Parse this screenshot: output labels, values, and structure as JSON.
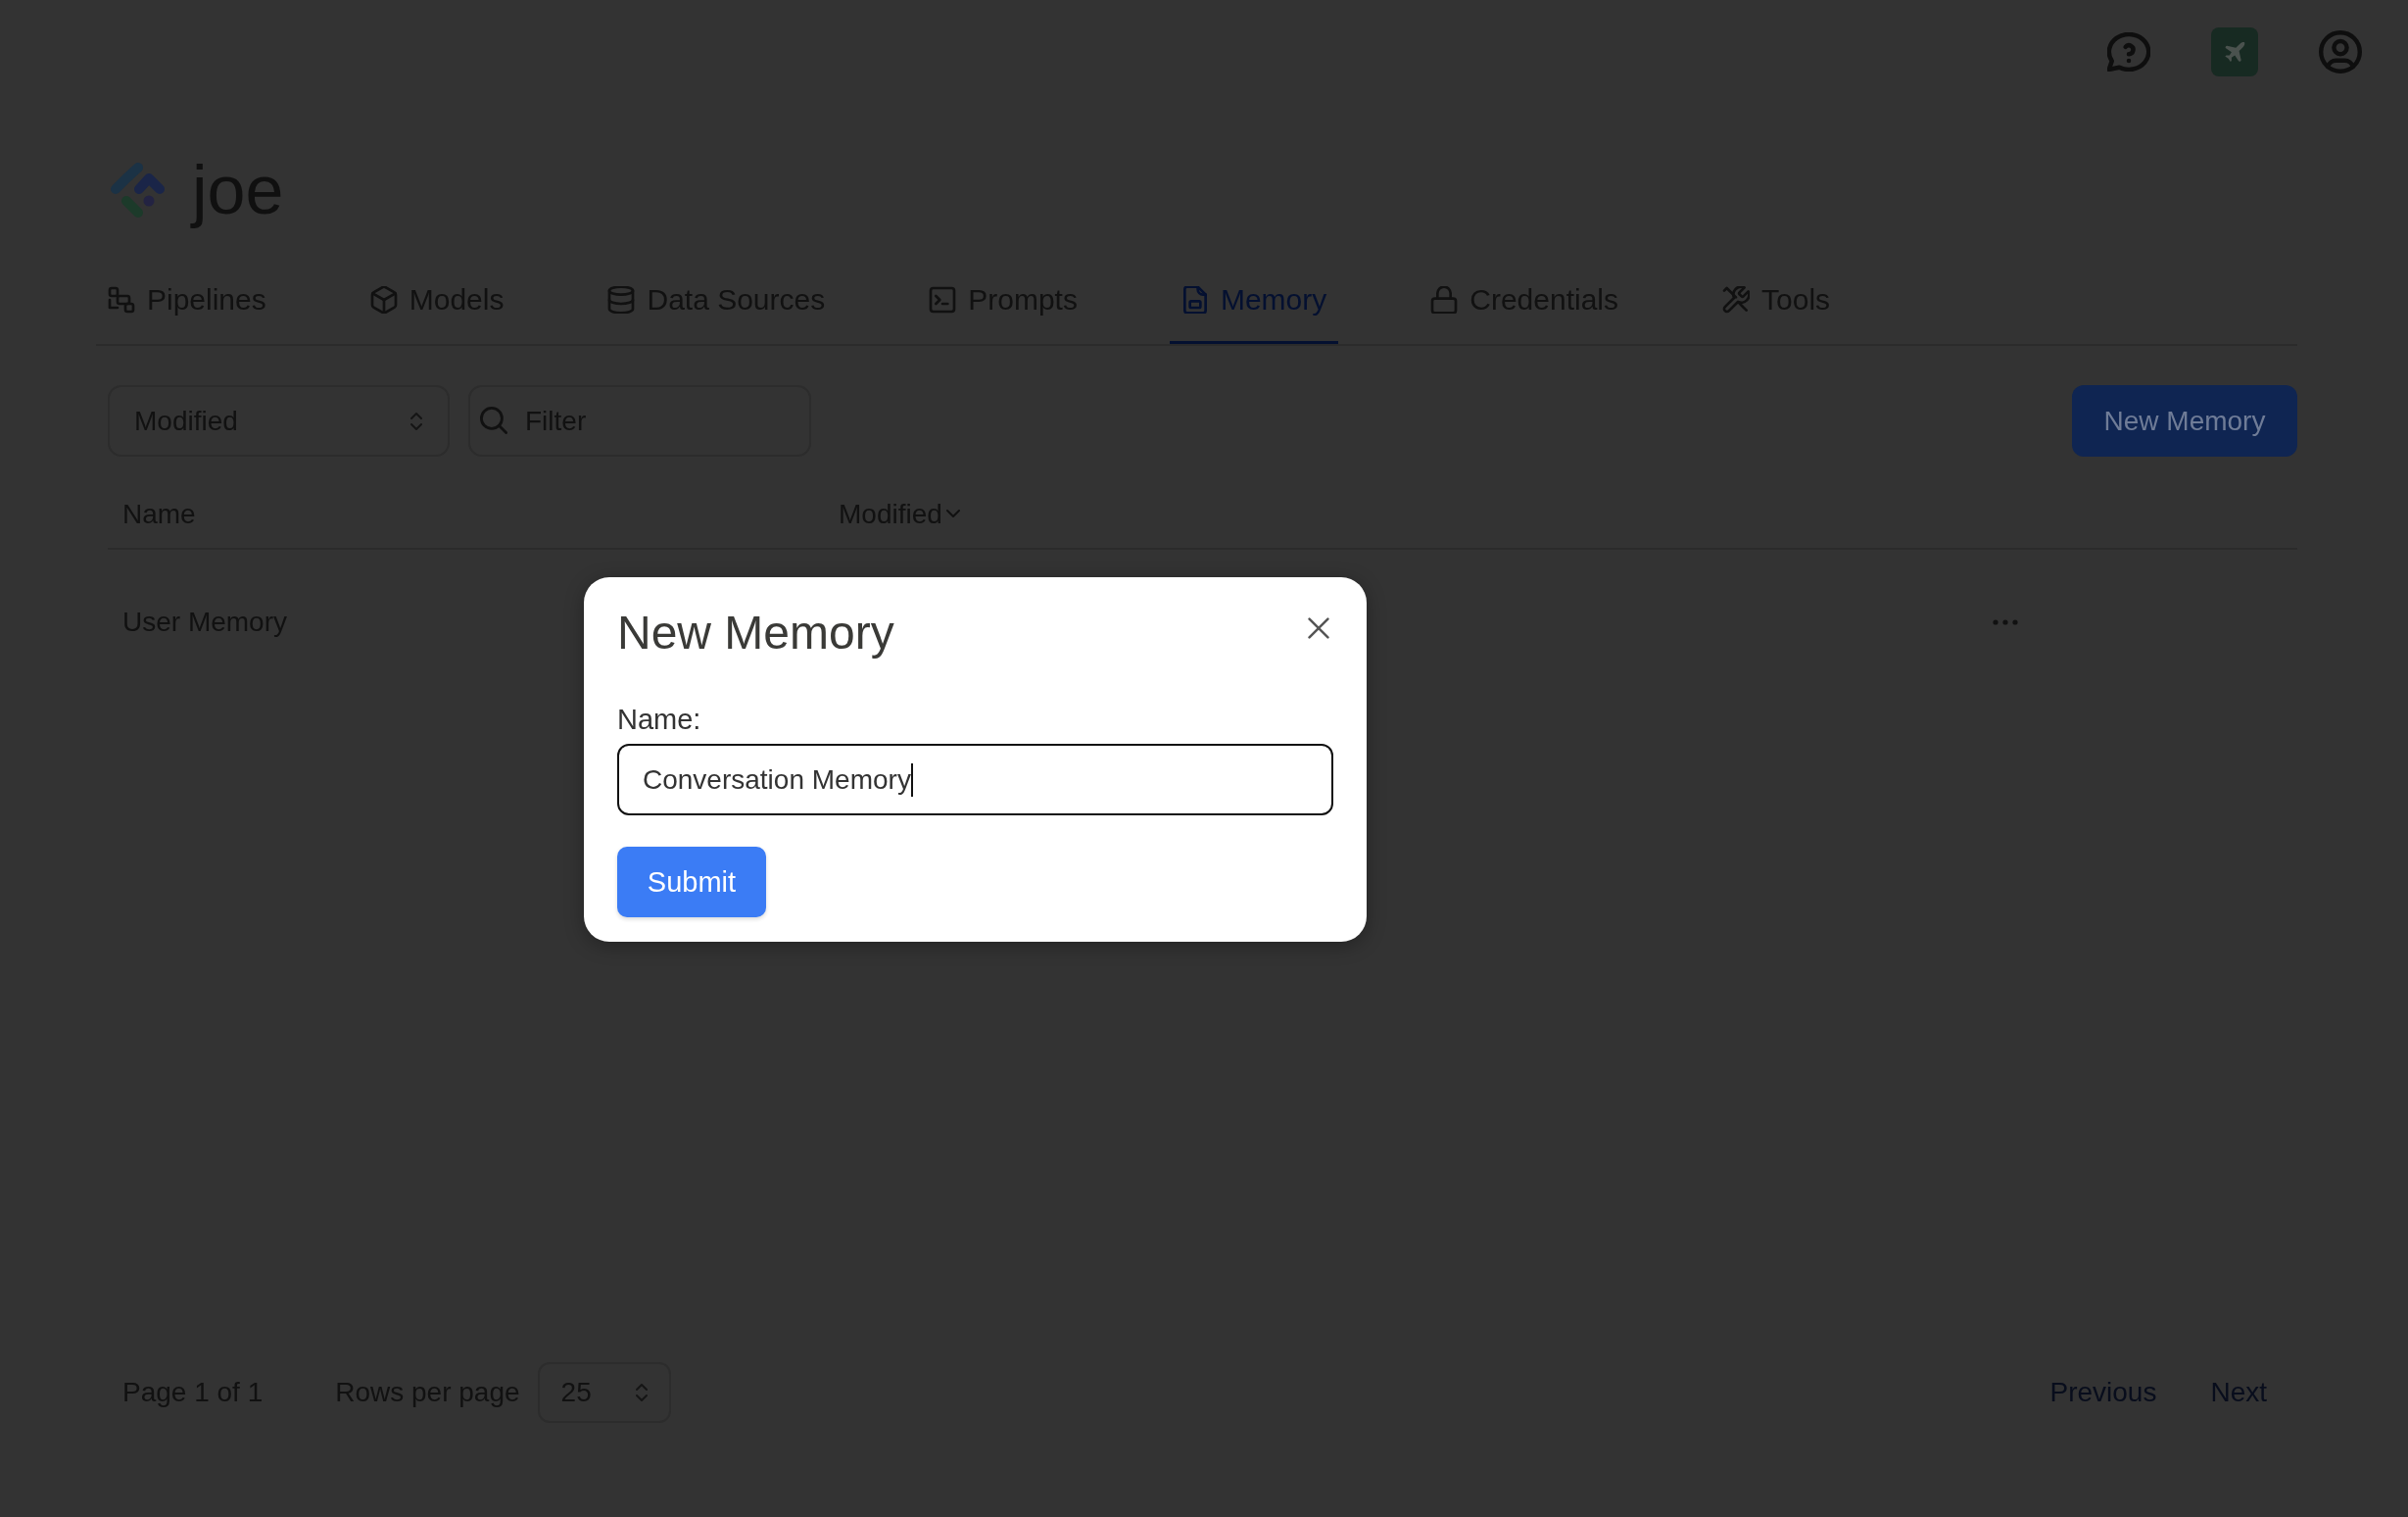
{
  "header": {
    "brand": "joe"
  },
  "tabs": [
    {
      "label": "Pipelines",
      "selected": false
    },
    {
      "label": "Models",
      "selected": false
    },
    {
      "label": "Data Sources",
      "selected": false
    },
    {
      "label": "Prompts",
      "selected": false
    },
    {
      "label": "Memory",
      "selected": true
    },
    {
      "label": "Credentials",
      "selected": false
    },
    {
      "label": "Tools",
      "selected": false
    }
  ],
  "toolbar": {
    "sort_select": {
      "value": "Modified"
    },
    "filter": {
      "placeholder": "Filter"
    },
    "new_button": {
      "label": "New Memory"
    }
  },
  "table": {
    "columns": [
      {
        "label": "Name",
        "sorted": false
      },
      {
        "label": "Modified",
        "sorted": true
      }
    ],
    "rows": [
      {
        "name": "User Memory"
      }
    ]
  },
  "pagination": {
    "page_info": "Page 1 of 1",
    "rows_per_page_label": "Rows per page",
    "rows_per_page": {
      "value": "25"
    },
    "previous": {
      "label": "Previous",
      "disabled": true
    },
    "next": {
      "label": "Next",
      "disabled": true
    }
  },
  "dialog": {
    "title": "New Memory",
    "field_label": "Name:",
    "field": {
      "value": "Conversation Memory",
      "focused": true
    },
    "submit": {
      "label": "Submit"
    }
  }
}
